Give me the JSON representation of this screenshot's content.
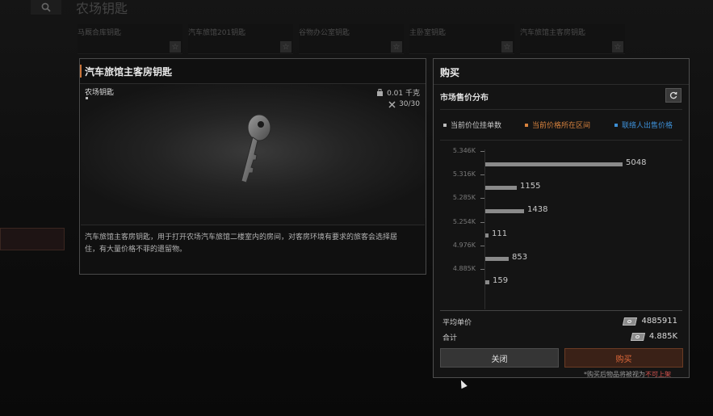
{
  "background": {
    "title": "农场钥匙",
    "keys": [
      {
        "label": "马厩合库钥匙"
      },
      {
        "label": "汽车旅馆201钥匙"
      },
      {
        "label": "谷物办公室钥匙"
      },
      {
        "label": "主卧室钥匙"
      },
      {
        "label": "汽车旅馆主客房钥匙"
      }
    ]
  },
  "item": {
    "title": "汽车旅馆主客房钥匙",
    "category": "农场钥匙",
    "weight": "0.01 千克",
    "durability": "30/30",
    "description_line1": "汽车旅馆主客房钥匙，用于打开农场汽车旅馆二楼室内的房间，对客房环境有要求的旅客会选择居",
    "description_line2": "住，有大量价格不菲的遗留物。"
  },
  "buy": {
    "title": "购买",
    "distribution_title": "市场售价分布",
    "legend": [
      {
        "label": "当前价位挂单数",
        "color": "#bdbdbd"
      },
      {
        "label": "当前价格所在区间",
        "color": "#d9833e"
      },
      {
        "label": "联络人出售价格",
        "color": "#3d8fd6"
      }
    ],
    "avg_label": "平均单价",
    "avg_value": "4885911",
    "total_label": "合计",
    "total_value": "4.885K",
    "close_label": "关闭",
    "buy_label": "购买",
    "note_prefix": "*购买后物品将被视为",
    "note_warn": "不可上架"
  },
  "colors": {
    "accent": "#c9743a",
    "buy_text": "#e0693a",
    "warn": "#d9534f"
  },
  "chart_data": {
    "type": "bar",
    "orientation": "horizontal",
    "categories": [
      "5.346K",
      "5.316K",
      "5.285K",
      "5.254K",
      "4.976K",
      "4.885K"
    ],
    "values": [
      5048,
      1155,
      1438,
      111,
      853,
      159
    ],
    "xlim": [
      0,
      5048
    ]
  }
}
